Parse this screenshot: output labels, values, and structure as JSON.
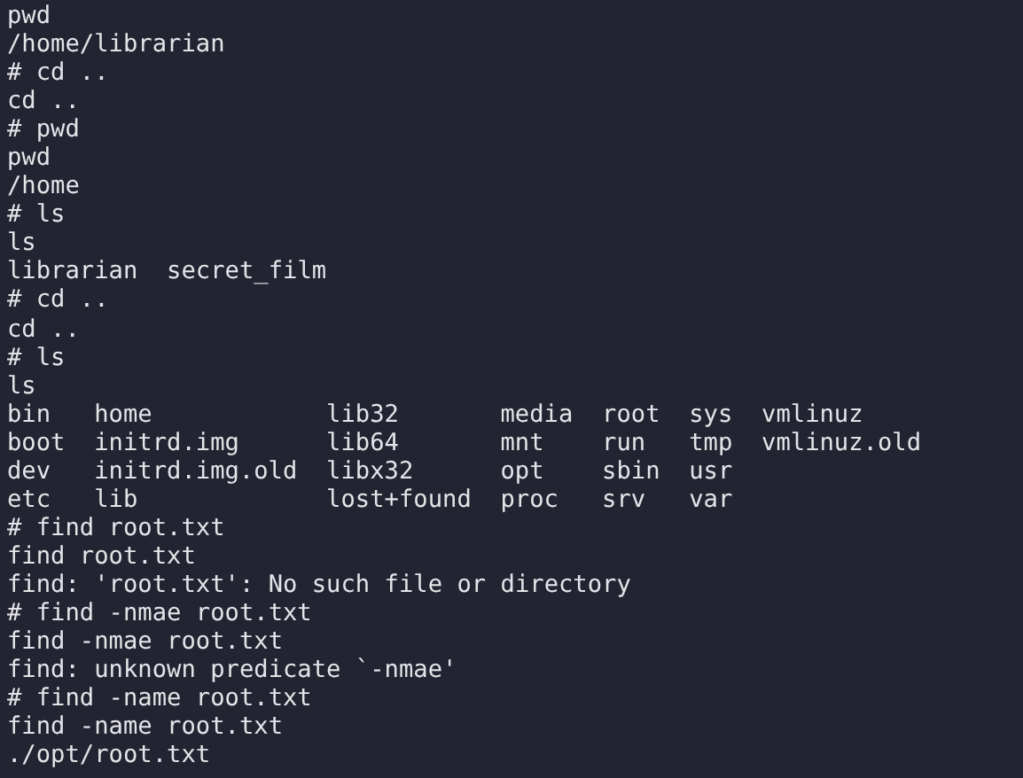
{
  "terminal": {
    "lines": [
      {
        "kind": "text",
        "text": "pwd"
      },
      {
        "kind": "text",
        "text": "/home/librarian"
      },
      {
        "kind": "text",
        "text": "# cd .."
      },
      {
        "kind": "text",
        "text": "cd .."
      },
      {
        "kind": "text",
        "text": "# pwd"
      },
      {
        "kind": "text",
        "text": "pwd"
      },
      {
        "kind": "text",
        "text": "/home"
      },
      {
        "kind": "text",
        "text": "# ls"
      },
      {
        "kind": "text",
        "text": "ls"
      },
      {
        "kind": "columns",
        "cells": [
          "librarian",
          "secret_film"
        ]
      },
      {
        "kind": "text",
        "text": "# cd .."
      },
      {
        "kind": "text",
        "text": "cd .."
      },
      {
        "kind": "text",
        "text": "# ls"
      },
      {
        "kind": "text",
        "text": "ls"
      },
      {
        "kind": "grid",
        "cells": [
          "bin",
          "home",
          "lib32",
          "media",
          "root",
          "sys",
          "vmlinuz"
        ]
      },
      {
        "kind": "grid",
        "cells": [
          "boot",
          "initrd.img",
          "lib64",
          "mnt",
          "run",
          "tmp",
          "vmlinuz.old"
        ]
      },
      {
        "kind": "grid",
        "cells": [
          "dev",
          "initrd.img.old",
          "libx32",
          "opt",
          "sbin",
          "usr"
        ]
      },
      {
        "kind": "grid",
        "cells": [
          "etc",
          "lib",
          "lost+found",
          "proc",
          "srv",
          "var"
        ]
      },
      {
        "kind": "text",
        "text": "# find root.txt"
      },
      {
        "kind": "text",
        "text": "find root.txt"
      },
      {
        "kind": "text",
        "text": "find: 'root.txt': No such file or directory"
      },
      {
        "kind": "text",
        "text": "# find -nmae root.txt"
      },
      {
        "kind": "text",
        "text": "find -nmae root.txt"
      },
      {
        "kind": "text",
        "text": "find: unknown predicate `-nmae'"
      },
      {
        "kind": "text",
        "text": "# find -name root.txt"
      },
      {
        "kind": "text",
        "text": "find -name root.txt"
      },
      {
        "kind": "text",
        "text": "./opt/root.txt"
      }
    ]
  }
}
